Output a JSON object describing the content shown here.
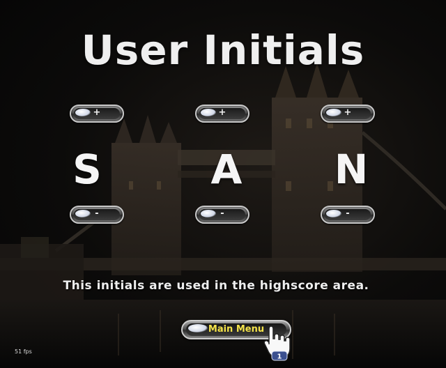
{
  "title": "User Initials",
  "initials": [
    {
      "letter": "S",
      "up_symbol": "+",
      "down_symbol": "-"
    },
    {
      "letter": "A",
      "up_symbol": "+",
      "down_symbol": "-"
    },
    {
      "letter": "N",
      "up_symbol": "+",
      "down_symbol": "-"
    }
  ],
  "info_text": "This initials are used in the highscore area.",
  "menu_button": {
    "label": "Main Menu"
  },
  "cursor": {
    "icon": "hand-pointer-icon",
    "badge": "1"
  },
  "fps_text": "51 fps",
  "colors": {
    "title": "#efefef",
    "button_label": "#f3e24a",
    "background": "#070707"
  }
}
